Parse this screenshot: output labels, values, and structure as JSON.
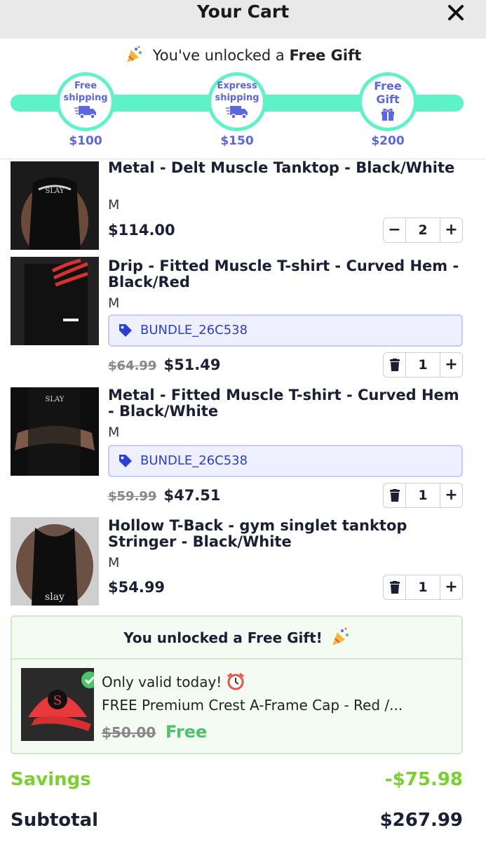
{
  "header": {
    "title": "Your Cart",
    "close_icon": "close-icon"
  },
  "rewards": {
    "message_prefix": "You've unlocked a",
    "message_bold": "Free Gift",
    "progress": 1.0,
    "milestones": [
      {
        "label_line1": "Free",
        "label_line2": "shipping",
        "icon": "truck-icon",
        "price": "$100"
      },
      {
        "label_line1": "Express",
        "label_line2": "shipping",
        "icon": "truck-icon",
        "price": "$150"
      },
      {
        "label_line1": "Free",
        "label_line2": "Gift",
        "icon": "gift-icon",
        "price": "$200"
      }
    ],
    "colors": {
      "track": "#5ef3c7",
      "accent": "#5a66e6"
    }
  },
  "items": [
    {
      "title": "Metal - Delt Muscle Tanktop - Black/White",
      "variant": "M",
      "price": "$114.00",
      "qty": "2",
      "minus_icon": "minus-icon",
      "plus_icon": "plus-icon"
    },
    {
      "title": "Drip - Fitted Muscle T-shirt - Curved Hem - Black/Red",
      "variant": "M",
      "bundle": "BUNDLE_26C538",
      "old_price": "$64.99",
      "price": "$51.49",
      "qty": "1",
      "minus_icon": "trash-icon",
      "plus_icon": "plus-icon"
    },
    {
      "title": "Metal - Fitted Muscle T-shirt - Curved Hem - Black/White",
      "variant": "M",
      "bundle": "BUNDLE_26C538",
      "old_price": "$59.99",
      "price": "$47.51",
      "qty": "1",
      "minus_icon": "trash-icon",
      "plus_icon": "plus-icon"
    },
    {
      "title": "Hollow T-Back - gym singlet tanktop Stringer - Black/White",
      "variant": "M",
      "price": "$54.99",
      "qty": "1",
      "minus_icon": "trash-icon",
      "plus_icon": "plus-icon"
    }
  ],
  "gift": {
    "heading": "You unlocked a Free Gift!",
    "valid_text": "Only valid today!",
    "name": "FREE Premium Crest A-Frame Cap - Red /...",
    "old_price": "$50.00",
    "price": "Free",
    "color": "#4cc46a"
  },
  "totals": {
    "savings_label": "Savings",
    "savings_value": "-$75.98",
    "subtotal_label": "Subtotal",
    "subtotal_value": "$267.99",
    "savings_color": "#7ad12d"
  }
}
